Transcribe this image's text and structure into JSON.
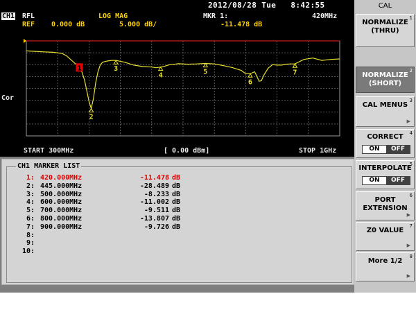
{
  "datetime": "2012/08/28 Tue   8:42:55",
  "header": {
    "channel": "CH1",
    "format_type": "RFL",
    "format": "LOG MAG",
    "marker_label": "MKR 1:",
    "marker_freq": "420MHz",
    "ref_label": "REF",
    "ref_value": "0.000 dB",
    "scale": "5.000 dB/",
    "marker_value": "-11.478 dB"
  },
  "left_annotation": "Cor",
  "footer": {
    "start": "START 300MHz",
    "power": "[ 0.00 dBm]",
    "stop": "STOP 1GHz"
  },
  "marker_list": {
    "title": "CH1 MARKER LIST",
    "rows": [
      {
        "index": "1:",
        "freq": "420.000MHz",
        "value": "-11.478",
        "unit": "dB",
        "active": true
      },
      {
        "index": "2:",
        "freq": "445.000MHz",
        "value": "-28.489",
        "unit": "dB"
      },
      {
        "index": "3:",
        "freq": "500.000MHz",
        "value": "-8.233",
        "unit": "dB"
      },
      {
        "index": "4:",
        "freq": "600.000MHz",
        "value": "-11.002",
        "unit": "dB"
      },
      {
        "index": "5:",
        "freq": "700.000MHz",
        "value": "-9.511",
        "unit": "dB"
      },
      {
        "index": "6:",
        "freq": "800.000MHz",
        "value": "-13.807",
        "unit": "dB"
      },
      {
        "index": "7:",
        "freq": "900.000MHz",
        "value": "-9.726",
        "unit": "dB"
      },
      {
        "index": "8:",
        "freq": "",
        "value": "",
        "unit": ""
      },
      {
        "index": "9:",
        "freq": "",
        "value": "",
        "unit": ""
      },
      {
        "index": "10:",
        "freq": "",
        "value": "",
        "unit": ""
      }
    ]
  },
  "softkeys": {
    "title": "CAL",
    "keys": [
      {
        "label": "NORMALIZE\n(THRU)",
        "num": "1"
      },
      {
        "label": "NORMALIZE\n(SHORT)",
        "num": "2"
      },
      {
        "label": "CAL MENUS",
        "num": "3"
      },
      {
        "label": "CORRECT",
        "num": "4",
        "toggle_on": "ON",
        "toggle_off": "OFF"
      },
      {
        "label": "INTERPOLATE",
        "num": "5",
        "toggle_on": "ON",
        "toggle_off": "OFF"
      },
      {
        "label": "PORT\nEXTENSION",
        "num": "6"
      },
      {
        "label": "Z0 VALUE",
        "num": "7"
      },
      {
        "label": "More 1/2",
        "num": "8"
      }
    ]
  },
  "colors": {
    "trace": "#e8e030",
    "ref_line": "#c81e1e",
    "grid": "#707070",
    "active_marker": "#e00000"
  },
  "chart_data": {
    "type": "line",
    "x_unit": "MHz",
    "xlim": [
      300,
      1000
    ],
    "ylabel": "dB",
    "ylim": [
      -40,
      0
    ],
    "reference_level": 0,
    "series": [
      {
        "x": [
          300,
          320,
          340,
          360,
          380,
          390,
          400,
          410,
          420,
          425,
          430,
          435,
          440,
          445,
          450,
          455,
          460,
          465,
          470,
          480,
          490,
          500,
          520,
          540,
          560,
          580,
          590,
          600,
          610,
          620,
          640,
          660,
          680,
          700,
          720,
          740,
          760,
          780,
          790,
          800,
          810,
          815,
          820,
          825,
          830,
          840,
          850,
          860,
          870,
          880,
          890,
          900,
          920,
          940,
          960,
          980,
          1000
        ],
        "y": [
          -4.2,
          -4.4,
          -4.6,
          -4.8,
          -5.3,
          -6.3,
          -8.0,
          -9.7,
          -11.5,
          -13.5,
          -16.5,
          -21.0,
          -25.5,
          -28.5,
          -24.0,
          -17.5,
          -13.0,
          -10.2,
          -9.0,
          -8.5,
          -8.2,
          -8.2,
          -9.0,
          -10.2,
          -10.8,
          -11.0,
          -11.3,
          -11.0,
          -10.6,
          -10.0,
          -9.6,
          -9.8,
          -9.7,
          -9.5,
          -9.7,
          -10.4,
          -11.2,
          -12.4,
          -13.8,
          -13.8,
          -13.0,
          -15.0,
          -17.0,
          -16.8,
          -14.6,
          -11.5,
          -10.0,
          -10.2,
          -10.2,
          -9.8,
          -9.7,
          -9.7,
          -7.8,
          -7.2,
          -8.2,
          -7.8,
          -7.6
        ]
      }
    ],
    "markers": [
      {
        "id": "1",
        "x": 420,
        "y": -11.478
      },
      {
        "id": "2",
        "x": 445,
        "y": -28.489
      },
      {
        "id": "3",
        "x": 500,
        "y": -8.233
      },
      {
        "id": "4",
        "x": 600,
        "y": -11.002
      },
      {
        "id": "5",
        "x": 700,
        "y": -9.511
      },
      {
        "id": "6",
        "x": 800,
        "y": -13.807
      },
      {
        "id": "7",
        "x": 900,
        "y": -9.726
      }
    ]
  }
}
